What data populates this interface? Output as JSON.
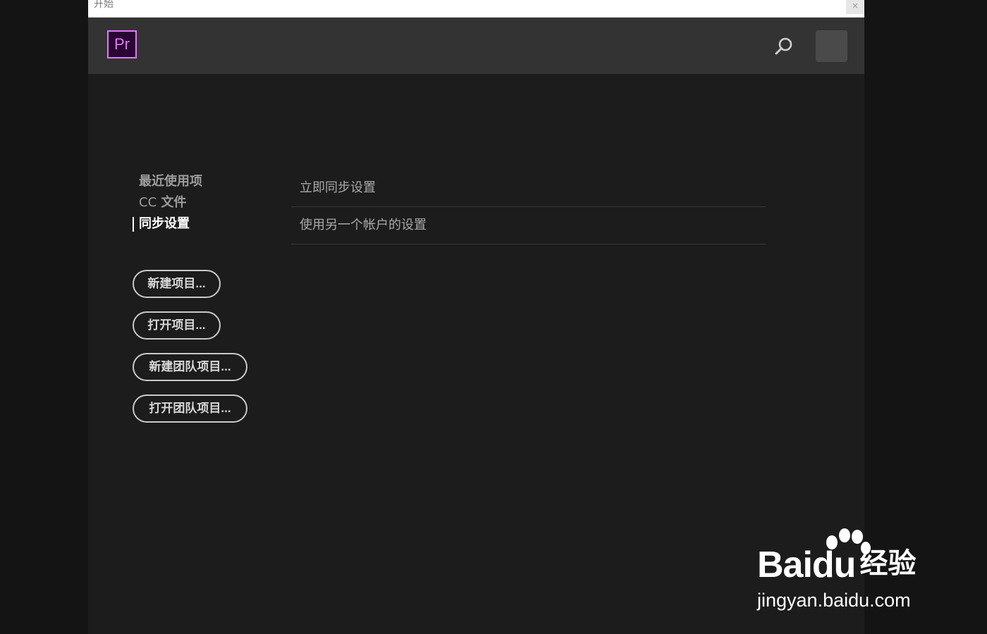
{
  "window": {
    "title": "开始",
    "close_label": "×"
  },
  "header": {
    "logo_text": "Pr",
    "search_icon": "search-icon",
    "avatar": "user-avatar"
  },
  "nav": {
    "items": [
      {
        "label": "最近使用项"
      },
      {
        "prefix": "CC",
        "label": "文件"
      },
      {
        "label": "同步设置"
      }
    ]
  },
  "actions": {
    "new_project": "新建项目...",
    "open_project": "打开项目...",
    "new_team_project": "新建团队项目...",
    "open_team_project": "打开团队项目..."
  },
  "sync": {
    "options": [
      "立即同步设置",
      "使用另一个帐户的设置"
    ]
  },
  "watermark": {
    "brand_left": "Bai",
    "brand_right": "du",
    "brand_cn": "经验",
    "url": "jingyan.baidu.com"
  },
  "colors": {
    "accent_logo": "#e07af9",
    "header_bg": "#333333",
    "body_bg": "#1c1c1c"
  }
}
